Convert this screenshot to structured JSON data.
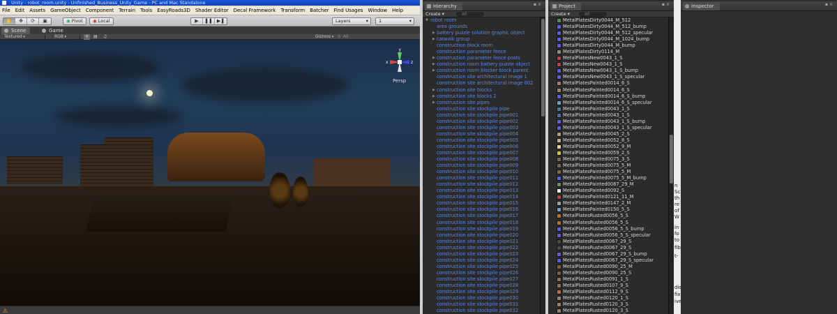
{
  "window": {
    "title": "Unity - robot_room.unity - Unfinished_Business_Unity_Game - PC and Mac Standalone"
  },
  "menu": [
    "File",
    "Edit",
    "Assets",
    "GameObject",
    "Component",
    "Terrain",
    "Tools",
    "EasyRoads3D",
    "Shader Editor",
    "Decal Framework",
    "Transform",
    "Batcher",
    "Find Usages",
    "Window",
    "Help"
  ],
  "toolbar": {
    "pivot_label": "Pivot",
    "local_label": "Local",
    "layers_label": "Layers",
    "layout_label": "1"
  },
  "view_tabs": {
    "scene": "Scene",
    "game": "Game"
  },
  "scene_bar": {
    "render_mode": "Textured",
    "color_mode": "RGB",
    "gizmos_label": "Gizmos",
    "search_all": "All"
  },
  "scene": {
    "gizmo_axes": {
      "y": "y",
      "x": "x",
      "z": "z"
    },
    "projection": "Persp"
  },
  "hierarchy": {
    "tab_label": "Hierarchy",
    "create_label": "Create",
    "filter_label": "All",
    "items": [
      {
        "label": "robot room",
        "indent": 0,
        "expand": "open"
      },
      {
        "label": "area grounds",
        "indent": 1,
        "expand": ""
      },
      {
        "label": "battery puzzle solution graphic object",
        "indent": 1,
        "expand": "closed"
      },
      {
        "label": "catwalk group",
        "indent": 1,
        "expand": "closed"
      },
      {
        "label": "construction block room",
        "indent": 1,
        "expand": ""
      },
      {
        "label": "construction parameter fence",
        "indent": 1,
        "expand": ""
      },
      {
        "label": "construction parameter fence posts",
        "indent": 1,
        "expand": "closed"
      },
      {
        "label": "construction room battery puzzle object",
        "indent": 1,
        "expand": "closed"
      },
      {
        "label": "construction room blocker block parent",
        "indent": 1,
        "expand": "closed"
      },
      {
        "label": "construction site architectural image 1",
        "indent": 1,
        "expand": ""
      },
      {
        "label": "construction site architectural image 002",
        "indent": 1,
        "expand": ""
      },
      {
        "label": "construction site blocks",
        "indent": 1,
        "expand": "closed"
      },
      {
        "label": "construction site blocks 2",
        "indent": 1,
        "expand": "closed"
      },
      {
        "label": "construction site pipes",
        "indent": 1,
        "expand": "closed"
      },
      {
        "label": "construction site stockpile pipe",
        "indent": 1,
        "expand": ""
      },
      {
        "label": "construction site stockpile pipe001",
        "indent": 1,
        "expand": ""
      },
      {
        "label": "construction site stockpile pipe002",
        "indent": 1,
        "expand": ""
      },
      {
        "label": "construction site stockpile pipe003",
        "indent": 1,
        "expand": ""
      },
      {
        "label": "construction site stockpile pipe004",
        "indent": 1,
        "expand": ""
      },
      {
        "label": "construction site stockpile pipe005",
        "indent": 1,
        "expand": ""
      },
      {
        "label": "construction site stockpile pipe006",
        "indent": 1,
        "expand": ""
      },
      {
        "label": "construction site stockpile pipe007",
        "indent": 1,
        "expand": ""
      },
      {
        "label": "construction site stockpile pipe008",
        "indent": 1,
        "expand": ""
      },
      {
        "label": "construction site stockpile pipe009",
        "indent": 1,
        "expand": ""
      },
      {
        "label": "construction site stockpile pipe010",
        "indent": 1,
        "expand": ""
      },
      {
        "label": "construction site stockpile pipe011",
        "indent": 1,
        "expand": ""
      },
      {
        "label": "construction site stockpile pipe012",
        "indent": 1,
        "expand": ""
      },
      {
        "label": "construction site stockpile pipe013",
        "indent": 1,
        "expand": ""
      },
      {
        "label": "construction site stockpile pipe014",
        "indent": 1,
        "expand": ""
      },
      {
        "label": "construction site stockpile pipe015",
        "indent": 1,
        "expand": ""
      },
      {
        "label": "construction site stockpile pipe016",
        "indent": 1,
        "expand": ""
      },
      {
        "label": "construction site stockpile pipe017",
        "indent": 1,
        "expand": ""
      },
      {
        "label": "construction site stockpile pipe018",
        "indent": 1,
        "expand": ""
      },
      {
        "label": "construction site stockpile pipe019",
        "indent": 1,
        "expand": ""
      },
      {
        "label": "construction site stockpile pipe020",
        "indent": 1,
        "expand": ""
      },
      {
        "label": "construction site stockpile pipe021",
        "indent": 1,
        "expand": ""
      },
      {
        "label": "construction site stockpile pipe022",
        "indent": 1,
        "expand": ""
      },
      {
        "label": "construction site stockpile pipe023",
        "indent": 1,
        "expand": ""
      },
      {
        "label": "construction site stockpile pipe024",
        "indent": 1,
        "expand": ""
      },
      {
        "label": "construction site stockpile pipe025",
        "indent": 1,
        "expand": ""
      },
      {
        "label": "construction site stockpile pipe026",
        "indent": 1,
        "expand": ""
      },
      {
        "label": "construction site stockpile pipe027",
        "indent": 1,
        "expand": ""
      },
      {
        "label": "construction site stockpile pipe028",
        "indent": 1,
        "expand": ""
      },
      {
        "label": "construction site stockpile pipe029",
        "indent": 1,
        "expand": ""
      },
      {
        "label": "construction site stockpile pipe030",
        "indent": 1,
        "expand": ""
      },
      {
        "label": "construction site stockpile pipe031",
        "indent": 1,
        "expand": ""
      },
      {
        "label": "construction site stockpile pipe032",
        "indent": 1,
        "expand": ""
      }
    ]
  },
  "project": {
    "tab_label": "Project",
    "create_label": "Create",
    "filter_label": "All",
    "items": [
      {
        "label": "MetalPlatesDirty0044_M_512",
        "swatch": "#5a8a5a"
      },
      {
        "label": "MetalPlatesDirty0044_M_512_bump",
        "swatch": "#5c5cf0"
      },
      {
        "label": "MetalPlatesDirty0044_M_512_specular",
        "swatch": "#5c5cf0"
      },
      {
        "label": "MetalPlatesDirty0044_M_1024_bump",
        "swatch": "#5c5cf0"
      },
      {
        "label": "MetalPlatesDirty0044_M_bump",
        "swatch": "#5c5cf0"
      },
      {
        "label": "MetalPlatesDirty0114_M",
        "swatch": "#8a8a8a"
      },
      {
        "label": "MetalPlatesNew0043_1_S",
        "swatch": "#c04040"
      },
      {
        "label": "MetalPlatesNew0043_1_S",
        "swatch": "#c04040"
      },
      {
        "label": "MetalPlatesNew0043_1_S_bump",
        "swatch": "#5c5cf0"
      },
      {
        "label": "MetalPlatesNew0043_1_S_specular",
        "swatch": "#5c5cf0"
      },
      {
        "label": "MetalPlatesPainted0014_6_S",
        "swatch": "#a08060"
      },
      {
        "label": "MetalPlatesPainted0014_6_S",
        "swatch": "#a08060"
      },
      {
        "label": "MetalPlatesPainted0014_6_S_bump",
        "swatch": "#5c5cf0"
      },
      {
        "label": "MetalPlatesPainted0014_6_S_specular",
        "swatch": "#6aa0d0"
      },
      {
        "label": "MetalPlatesPainted0043_1_S",
        "swatch": "#4a7a9a"
      },
      {
        "label": "MetalPlatesPainted0043_1_S",
        "swatch": "#4a7a9a"
      },
      {
        "label": "MetalPlatesPainted0043_1_S_bump",
        "swatch": "#5c5cf0"
      },
      {
        "label": "MetalPlatesPainted0043_1_S_specular",
        "swatch": "#5c5cf0"
      },
      {
        "label": "MetalPlatesPainted0045_2_S",
        "swatch": "#b09a7a"
      },
      {
        "label": "MetalPlatesPainted0052_8_S",
        "swatch": "#c0b080"
      },
      {
        "label": "MetalPlatesPainted0052_9_M",
        "swatch": "#e0d0a0"
      },
      {
        "label": "MetalPlatesPainted0059_2_S",
        "swatch": "#e0c020"
      },
      {
        "label": "MetalPlatesPainted0075_3_S",
        "swatch": "#7a6a4a"
      },
      {
        "label": "MetalPlatesPainted0075_5_M",
        "swatch": "#7a6a4a"
      },
      {
        "label": "MetalPlatesPainted0075_5_M",
        "swatch": "#7a6a4a"
      },
      {
        "label": "MetalPlatesPainted0075_5_M_bump",
        "swatch": "#5c5cf0"
      },
      {
        "label": "MetalPlatesPainted0087_29_M",
        "swatch": "#6a8a6a"
      },
      {
        "label": "MetalPlatesPainted0092_S",
        "swatch": "#ececec"
      },
      {
        "label": "MetalPlatesPainted0121_11_M",
        "swatch": "#c04040"
      },
      {
        "label": "MetalPlatesPainted0147_2_M",
        "swatch": "#a0a0a0"
      },
      {
        "label": "MetalPlatesPainted0150_5_S",
        "swatch": "#6aa0d0"
      },
      {
        "label": "MetalPlatesRusted0056_5_S",
        "swatch": "#c07020"
      },
      {
        "label": "MetalPlatesRusted0056_5_S",
        "swatch": "#c07020"
      },
      {
        "label": "MetalPlatesRusted0056_5_S_bump",
        "swatch": "#5c5cf0"
      },
      {
        "label": "MetalPlatesRusted0056_5_S_specular",
        "swatch": "#5c5cf0"
      },
      {
        "label": "MetalPlatesRusted0067_29_S",
        "swatch": "#4a4a4a"
      },
      {
        "label": "MetalPlatesRusted0067_29_S",
        "swatch": "#4a4a4a"
      },
      {
        "label": "MetalPlatesRusted0067_29_S_bump",
        "swatch": "#5c5cf0"
      },
      {
        "label": "MetalPlatesRusted0067_29_S_specular",
        "swatch": "#5c5cf0"
      },
      {
        "label": "MetalPlatesRusted0090_25_M",
        "swatch": "#8a5a3a"
      },
      {
        "label": "MetalPlatesRusted0090_25_S",
        "swatch": "#8a5a3a"
      },
      {
        "label": "MetalPlatesRusted0091_1_S",
        "swatch": "#9a6a4a"
      },
      {
        "label": "MetalPlatesRusted0107_9_S",
        "swatch": "#9a6a4a"
      },
      {
        "label": "MetalPlatesRusted0112_9_S",
        "swatch": "#c07040"
      },
      {
        "label": "MetalPlatesRusted0120_1_S",
        "swatch": "#a08060"
      },
      {
        "label": "MetalPlatesRusted0120_3_S",
        "swatch": "#a08060"
      },
      {
        "label": "MetalPlatesRusted0120_3_S",
        "swatch": "#a08060"
      }
    ]
  },
  "inspector": {
    "tab_label": "Inspector"
  },
  "behind_window": {
    "fragments": [
      "n",
      "Sc",
      "th",
      "re",
      "of",
      "W",
      "in",
      "fo",
      "to",
      "fib",
      "t-",
      "dis",
      "fix",
      "ive"
    ]
  },
  "colors": {
    "hierarchy_text": "#5e86e0",
    "panel_bg": "#2b2b2b",
    "titlebar": "#1a58d6"
  }
}
